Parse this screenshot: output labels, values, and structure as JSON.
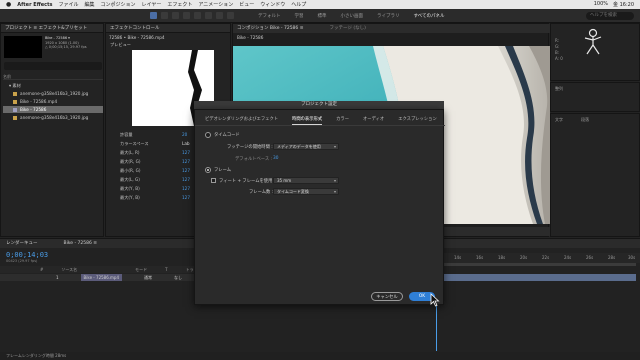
{
  "menubar": {
    "apple": "",
    "app_name": "After Effects",
    "items": [
      "ファイル",
      "編集",
      "コンポジション",
      "レイヤー",
      "エフェクト",
      "アニメーション",
      "ビュー",
      "ウィンドウ",
      "ヘルプ"
    ],
    "status_right": [
      "100%",
      "金 16:20"
    ]
  },
  "toolbar": {
    "workspaces": [
      "デフォルト",
      "学習",
      "標準",
      "小さい画面",
      "ライブラリ",
      "すべてのパネル"
    ],
    "active_workspace": "すべてのパネル",
    "search_placeholder": "ヘルプを検索"
  },
  "project_panel": {
    "tab": "プロジェクト ≡   エフェクト&プリセット",
    "selected_name": "Bike - 72586 ▾",
    "info": "1920 x 1080 (1.00)\n△ 0;00;15;15, 29.97 fps",
    "column_header": "名前",
    "items": [
      {
        "label": "▾ 素材",
        "selected": false
      },
      {
        "label": "anemone-g358e416b3_1920.jpg",
        "selected": false
      },
      {
        "label": "Bike - 72586.mp4",
        "selected": false
      },
      {
        "label": "Bike - 72586",
        "selected": true
      },
      {
        "label": "anemone-g358e416b3_1920.jpg",
        "selected": false
      }
    ]
  },
  "effects_panel": {
    "tab": "エフェクトコントロール",
    "subtitle": "72586 • Bike - 72586.mp4",
    "preview_label": "プレビュー",
    "rows": [
      {
        "label": "許容量",
        "value": "20"
      },
      {
        "label": "カラースペース",
        "value": "Lab"
      },
      {
        "label": "最大(L, R)",
        "value": "127"
      },
      {
        "label": "最大(R, G)",
        "value": "127"
      },
      {
        "label": "最小(R, G)",
        "value": "127"
      },
      {
        "label": "最大(L, G)",
        "value": "127"
      },
      {
        "label": "最大(Y, B)",
        "value": "127"
      },
      {
        "label": "最大(Y, B)",
        "value": "127"
      }
    ]
  },
  "comp_panel": {
    "tab": "コンポジション Bike - 72586 ≡",
    "footage_tab": "フッテージ (なし)",
    "breadcrumb": "Bike - 72586"
  },
  "right_panels": {
    "info_values": [
      "R: ",
      "G: ",
      "B: ",
      "A: 0"
    ],
    "align_label": "整列",
    "chars_label": "文字",
    "para_label": "段落"
  },
  "timeline": {
    "tabs": [
      "レンダーキュー",
      "Bike - 72586 ≡"
    ],
    "timecode": "0;00;14;03",
    "frames": "00423 (29.97 fps)",
    "col_headers": [
      "#",
      "ソース名",
      "モード",
      "T",
      "トラックマット"
    ],
    "layer": {
      "index": "1",
      "name": "Bike - 72586.mp4",
      "mode": "通常",
      "matte": "なし"
    },
    "ruler_ticks": [
      "14s",
      "16s",
      "18s",
      "20s",
      "22s",
      "24s",
      "26s",
      "28s",
      "30s"
    ],
    "status": "フレームレンダリング時間  28ms"
  },
  "modal": {
    "title": "プロジェクト設定",
    "tabs": [
      {
        "label": "ビデオレンダリングおよびエフェクト",
        "active": false
      },
      {
        "label": "時間の表示形式",
        "active": true
      },
      {
        "label": "カラー",
        "active": false
      },
      {
        "label": "オーディオ",
        "active": false
      },
      {
        "label": "エクスプレッション",
        "active": false
      }
    ],
    "timecode_option": "タイムコード",
    "footage_start_label": "フッテージの開始時間 :",
    "footage_start_value": "メディアのデータを使用",
    "default_base_label": "デフォルトベース :",
    "default_base_value": "30",
    "frames_option": "フレーム",
    "film_feet_label": "フィート + フレームを使用 :",
    "film_feet_value": "35 mm",
    "frame_count_label": "フレーム数 :",
    "frame_count_value": "タイムコード変換",
    "cancel_label": "キャンセル",
    "ok_label": "OK"
  },
  "colors": {
    "accent_blue": "#2f7fd6",
    "timecode_blue": "#4a9de8",
    "sea": "#48b6c0",
    "sand": "#e9e7e0"
  }
}
